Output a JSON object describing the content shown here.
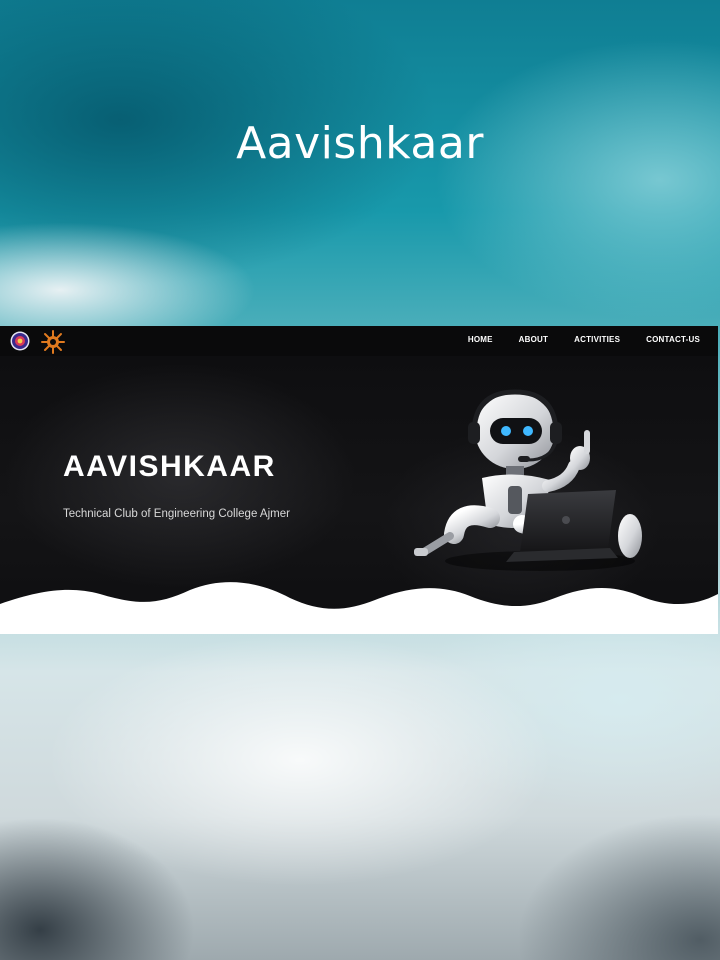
{
  "page": {
    "title": "Aavishkaar"
  },
  "site": {
    "nav": {
      "logos": [
        "college-emblem-icon",
        "club-sun-gear-icon"
      ],
      "links": [
        "HOME",
        "ABOUT",
        "ACTIVITIES",
        "CONTACT-US"
      ]
    },
    "hero": {
      "title": "AAVISHKAAR",
      "subtitle": "Technical Club of Engineering College Ajmer",
      "illustration": "robot-with-laptop-icon"
    }
  },
  "colors": {
    "hero_background": "#111113",
    "navbar_background": "#0a0a0b",
    "text_primary": "#ffffff",
    "robot_eye": "#3fb8ff",
    "wave": "#ffffff",
    "backdrop_teal": "#1899ab"
  }
}
